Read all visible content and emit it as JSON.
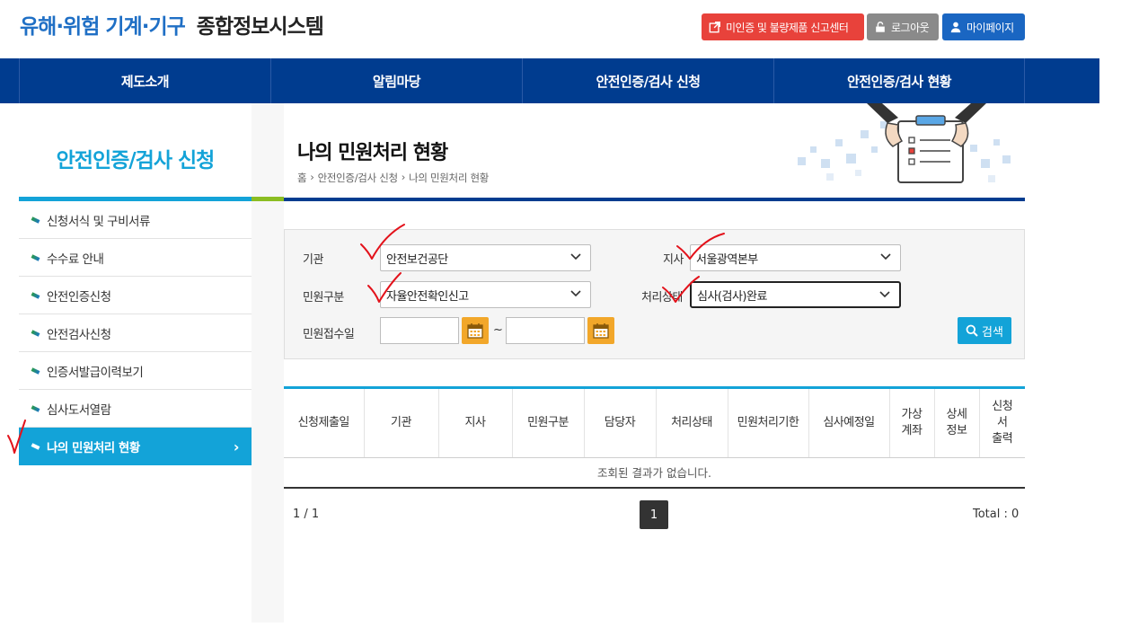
{
  "header": {
    "title_blue": "유해·위험 기계·기구",
    "title_dark": "종합정보시스템",
    "buttons": {
      "report": "미인증 및 불량제품 신고센터",
      "logout": "로그아웃",
      "mypage": "마이페이지"
    }
  },
  "nav": {
    "items": [
      "제도소개",
      "알림마당",
      "안전인증/검사 신청",
      "안전인증/검사 현황"
    ]
  },
  "sidebar": {
    "title": "안전인증/검사 신청",
    "items": [
      {
        "label": "신청서식 및 구비서류"
      },
      {
        "label": "수수료 안내"
      },
      {
        "label": "안전인증신청"
      },
      {
        "label": "안전검사신청"
      },
      {
        "label": "인증서발급이력보기"
      },
      {
        "label": "심사도서열람"
      },
      {
        "label": "나의 민원처리 현황",
        "active": true
      }
    ]
  },
  "content": {
    "heading": "나의 민원처리 현황",
    "breadcrumb": [
      "홈",
      "안전인증/검사 신청",
      "나의 민원처리 현황"
    ]
  },
  "search": {
    "agency_label": "기관",
    "agency_value": "안전보건공단",
    "branch_label": "지사",
    "branch_value": "서울광역본부",
    "type_label": "민원구분",
    "type_value": "자율안전확인신고",
    "status_label": "처리상태",
    "status_value": "심사(검사)완료",
    "date_label": "민원접수일",
    "date_tilde": "~",
    "search_button": "검색"
  },
  "table": {
    "headers": [
      "신청제출일",
      "기관",
      "지사",
      "민원구분",
      "담당자",
      "처리상태",
      "민원처리기한",
      "심사예정일",
      "가상\n계좌",
      "상세\n정보",
      "신청\n서\n출력"
    ],
    "empty_message": "조회된 결과가 없습니다."
  },
  "pager": {
    "info": "1 / 1",
    "current_page": "1",
    "total": "Total : 0"
  },
  "colors": {
    "nav_bg": "#003c8f",
    "accent": "#13a3d8",
    "report_btn": "#e8423b",
    "calendar": "#f2a72a"
  }
}
